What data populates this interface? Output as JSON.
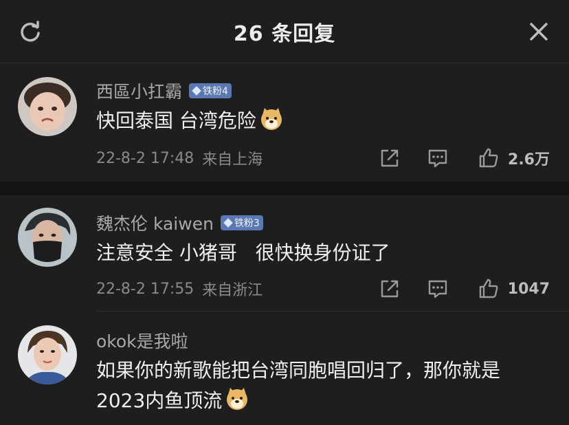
{
  "header": {
    "title": "26 条回复"
  },
  "comments": [
    {
      "username": "西區小扛霸",
      "badge": "铁粉4",
      "text": "快回泰国 台湾危险",
      "time": "22-8-2 17:48",
      "location": "来自上海",
      "likes": "2.6万"
    },
    {
      "username": "魏杰伦 kaiwen",
      "badge": "铁粉3",
      "text": "注意安全 小猪哥   很快换身份证了",
      "time": "22-8-2 17:55",
      "location": "来自浙江",
      "likes": "1047"
    },
    {
      "username": "okok是我啦",
      "text_line1": "如果你的新歌能把台湾同胞唱回归了，那你就是",
      "text_line2": "2023内鱼顶流"
    }
  ],
  "icons": {
    "refresh": "refresh-icon",
    "close": "close-icon",
    "share": "share-icon",
    "reply": "comment-icon",
    "like": "thumbs-up-icon",
    "emoji": "doge-emoji"
  },
  "colors": {
    "background": "#1e1e1e",
    "badge": "#5a79b4",
    "separator": "#151515"
  }
}
